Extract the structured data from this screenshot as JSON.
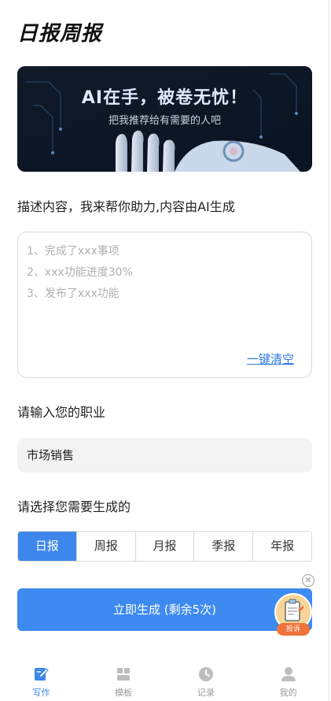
{
  "app_title": "日报周报",
  "banner": {
    "title": "AI在手，被卷无忧！",
    "subtitle": "把我推荐给有需要的人吧"
  },
  "description": {
    "label": "描述内容，我来帮你助力,内容由AI生成",
    "placeholder_lines": [
      "1、完成了xxx事项",
      "2、xxx功能进度30%",
      "3、发布了xxx功能"
    ],
    "clear_label": "一键清空"
  },
  "job": {
    "label": "请输入您的职业",
    "value": "市场销售"
  },
  "report_type": {
    "label": "请选择您需要生成的",
    "options": [
      "日报",
      "周报",
      "月报",
      "季报",
      "年报"
    ],
    "selected": "日报"
  },
  "generate_button": "立即生成 (剩余5次)",
  "complain_label": "投诉",
  "nav": {
    "items": [
      {
        "label": "写作",
        "icon": "edit-icon",
        "active": true
      },
      {
        "label": "模板",
        "icon": "template-icon",
        "active": false
      },
      {
        "label": "记录",
        "icon": "clock-icon",
        "active": false
      },
      {
        "label": "我的",
        "icon": "user-icon",
        "active": false
      }
    ]
  },
  "colors": {
    "accent": "#3d87ec",
    "link": "#2f7ae5",
    "complain": "#f0733a"
  }
}
